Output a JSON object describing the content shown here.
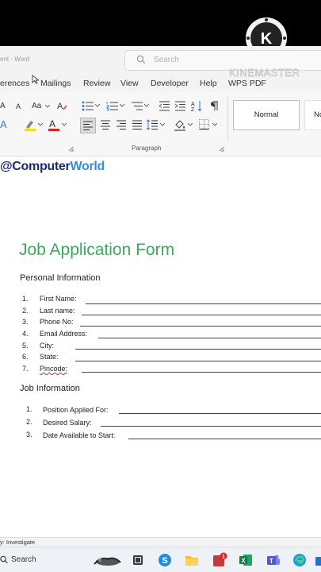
{
  "window": {
    "doc_title": "ent - Word",
    "search_placeholder": "Search"
  },
  "tabs": [
    "erences",
    "Mailings",
    "Review",
    "View",
    "Developer",
    "Help",
    "WPS PDF"
  ],
  "ribbon": {
    "font_grow": "A",
    "font_shrink": "A",
    "change_case": "Aa",
    "style_normal": "Normal",
    "style_next": "No",
    "group_paragraph": "Paragraph"
  },
  "watermark": {
    "part1": "@Computer",
    "part2": "World"
  },
  "form": {
    "title": "Job Application Form",
    "personal_heading": "Personal Information",
    "personal_fields": [
      {
        "num": "1.",
        "label": "First Name:"
      },
      {
        "num": "2.",
        "label": "Last name:"
      },
      {
        "num": "3.",
        "label": "Phone No:"
      },
      {
        "num": "4.",
        "label": "Email Address:"
      },
      {
        "num": "5.",
        "label": "City:"
      },
      {
        "num": "6.",
        "label": "State:"
      },
      {
        "num": "7.",
        "label": "Pincode:"
      }
    ],
    "job_heading": "Job Information",
    "job_fields": [
      {
        "num": "1.",
        "label": "Position Applied For:"
      },
      {
        "num": "2.",
        "label": "Desired Salary:"
      },
      {
        "num": "3.",
        "label": "Date Available to Start:"
      }
    ]
  },
  "status": {
    "text": "y: Investigate"
  },
  "taskbar": {
    "search_label": "Search",
    "badge": "1"
  },
  "overlay": {
    "brand": "KINEMASTER",
    "logo_letter": "K"
  },
  "colors": {
    "title_green": "#3fa75a",
    "watermark_navy": "#1e2a6e",
    "watermark_blue": "#2f8fdc"
  }
}
